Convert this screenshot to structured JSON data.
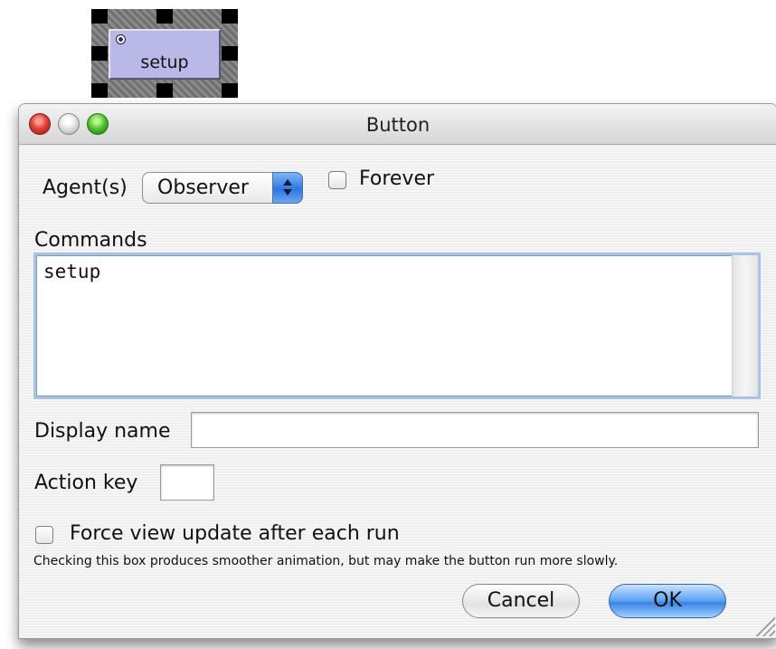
{
  "widget": {
    "label": "setup"
  },
  "dialog": {
    "title": "Button",
    "agents_label": "Agent(s)",
    "agents_value": "Observer",
    "forever_label": "Forever",
    "forever_checked": false,
    "commands_label": "Commands",
    "commands_text": "setup",
    "display_name_label": "Display name",
    "display_name_value": "",
    "action_key_label": "Action key",
    "action_key_value": "",
    "force_update_label": "Force view update after each run",
    "force_update_checked": false,
    "hint_text": "Checking this box produces smoother animation, but may make the button run more slowly.",
    "cancel_label": "Cancel",
    "ok_label": "OK"
  },
  "colors": {
    "widget_button": "#b9b8e6",
    "ok_button": "#3a82e6",
    "focus_ring": "#a9c3e8"
  }
}
